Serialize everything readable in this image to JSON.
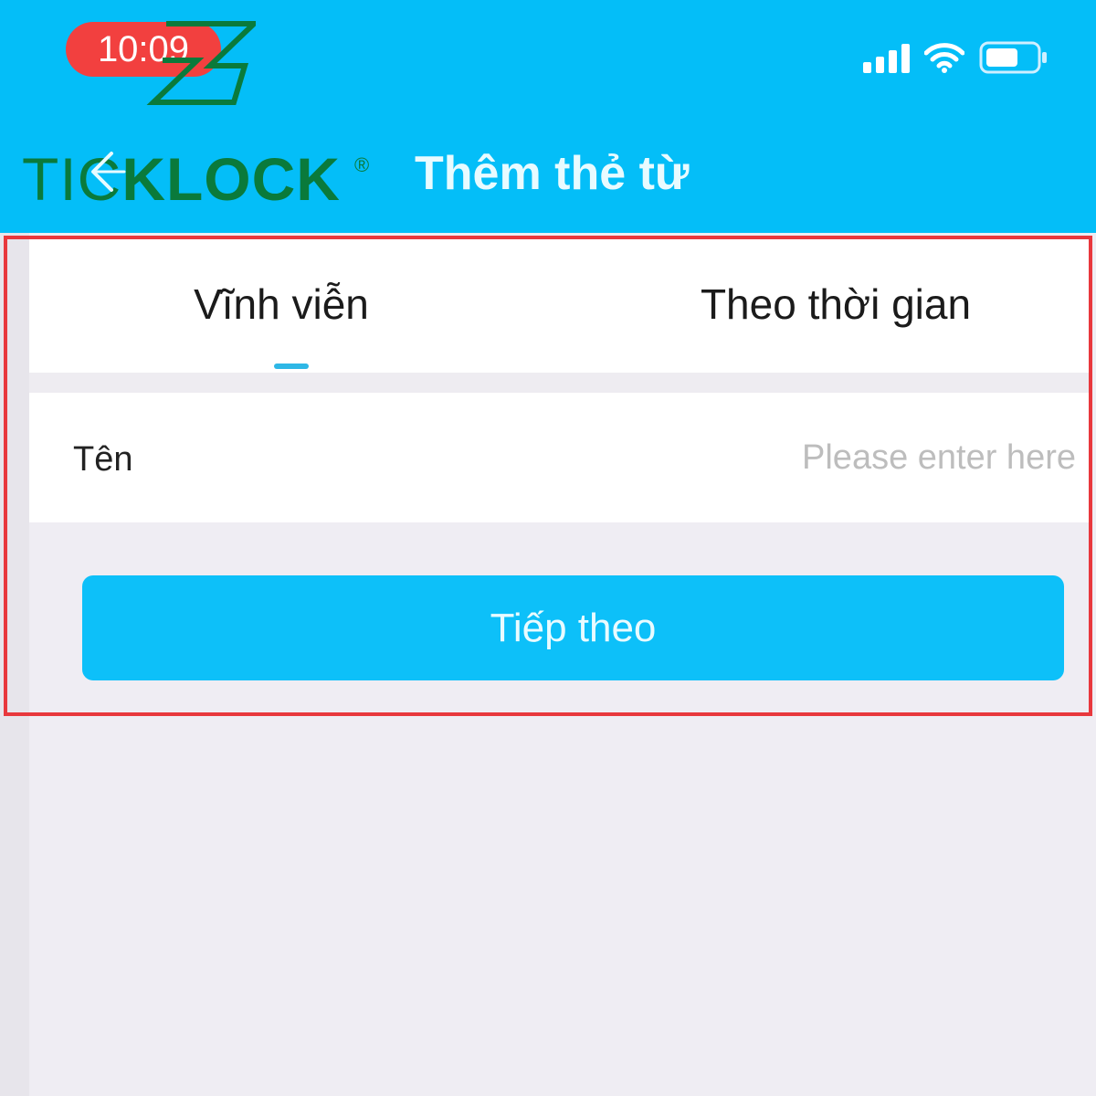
{
  "status_bar": {
    "time": "10:09",
    "icons": [
      "signal-icon",
      "wifi-icon",
      "battery-icon"
    ]
  },
  "logo": {
    "text_thin": "TIC",
    "text_bold": "KLOCK",
    "reg": "®"
  },
  "header": {
    "back_icon": "back-arrow-icon",
    "title": "Thêm thẻ từ"
  },
  "tabs": [
    {
      "label": "Vĩnh viễn",
      "active": true
    },
    {
      "label": "Theo thời gian",
      "active": false
    }
  ],
  "form": {
    "name_label": "Tên",
    "name_value": "",
    "name_placeholder": "Please enter here"
  },
  "actions": {
    "next_label": "Tiếp theo"
  },
  "colors": {
    "header_bg": "#04bef8",
    "button_bg": "#0dc0f9",
    "tab_indicator": "#2eb7e6",
    "logo_green": "#0a7a3b",
    "highlight_border": "#e8383d",
    "time_pill": "#f2403f"
  }
}
